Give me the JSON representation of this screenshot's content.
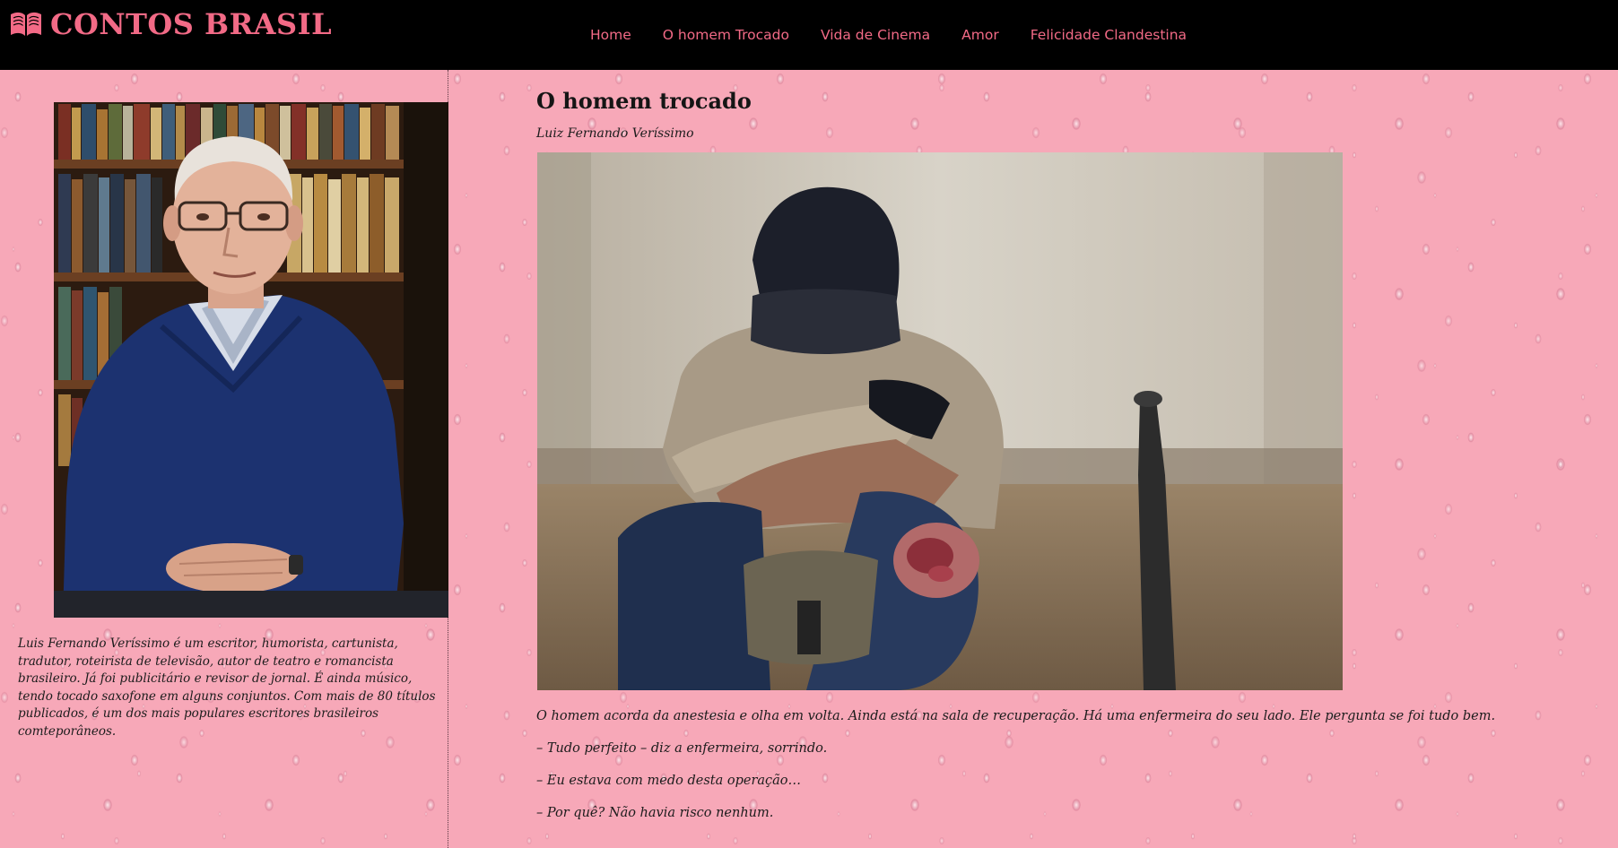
{
  "site": {
    "brand": "CONTOS BRASIL",
    "brand_icon": "open-book-icon",
    "accent_color": "#f26a86",
    "background_color": "#f7a8b8",
    "header_color": "#000000"
  },
  "nav": {
    "items": [
      {
        "label": "Home"
      },
      {
        "label": "O homem Trocado"
      },
      {
        "label": "Vida de Cinema"
      },
      {
        "label": "Amor"
      },
      {
        "label": "Felicidade Clandestina"
      }
    ]
  },
  "sidebar": {
    "bio": "Luis Fernando Veríssimo é um escritor, humorista, cartunista, tradutor, roteirista de televisão, autor de teatro e romancista brasileiro. Já foi publicitário e revisor de jornal. É ainda músico, tendo tocado saxofone em alguns conjuntos. Com mais de 80 títulos publicados, é um dos mais populares escritores brasileiros comteporâneos."
  },
  "article": {
    "title": "O homem trocado",
    "author": "Luiz Fernando Veríssimo",
    "paragraphs": [
      "O homem acorda da anestesia e olha em volta. Ainda está na sala de recuperação. Há uma enfermeira do seu lado. Ele pergunta se foi tudo bem.",
      "– Tudo perfeito – diz a enfermeira, sorrindo.",
      "– Eu estava com medo desta operação…",
      "– Por quê? Não havia risco nenhum."
    ]
  }
}
